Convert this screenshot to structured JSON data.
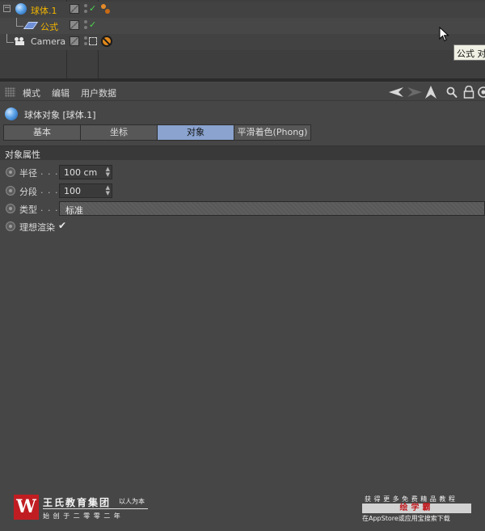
{
  "object_manager": {
    "objects": [
      {
        "name": "球体.1",
        "icon": "sphere-icon",
        "active": true
      },
      {
        "name": "公式",
        "icon": "formula-deformer-icon",
        "active": false
      },
      {
        "name": "Camera",
        "icon": "camera-icon",
        "active": false
      }
    ],
    "tooltip": "公式 对"
  },
  "attribute_manager": {
    "menu": [
      "模式",
      "编辑",
      "用户数据"
    ],
    "toolbar_icons": [
      "back-arrow-icon",
      "forward-arrow-icon",
      "up-arrow-icon",
      "search-icon",
      "lock-icon",
      "new-window-icon"
    ],
    "object_title": "球体对象 [球体.1]",
    "tabs": [
      {
        "label": "基本",
        "active": false
      },
      {
        "label": "坐标",
        "active": false
      },
      {
        "label": "对象",
        "active": true
      },
      {
        "label": "平滑着色(Phong)",
        "active": false
      }
    ],
    "section_title": "对象属性",
    "properties": {
      "radius": {
        "label": "半径",
        "dots": ". . .",
        "value": "100 cm"
      },
      "segments": {
        "label": "分段",
        "dots": ". . .",
        "value": "100"
      },
      "type": {
        "label": "类型",
        "dots": ". . .",
        "value": "标准"
      },
      "render_perfect": {
        "label": "理想渲染",
        "checked": true
      }
    }
  },
  "watermark_left": {
    "logo_letter": "W",
    "company": "王氏教育集团",
    "slogan": "以人为本",
    "founded": "始 创 于 二 零 零 二 年"
  },
  "watermark_right": {
    "line1": "获 得 更 多 免 费 精 品 教 程",
    "brand": "绘学霸",
    "line3": "在AppStore或应用宝搜索下载"
  },
  "colors": {
    "active_object_name": "#f2b400",
    "active_tab": "#8aa3cf",
    "logo_red": "#c01d22"
  }
}
